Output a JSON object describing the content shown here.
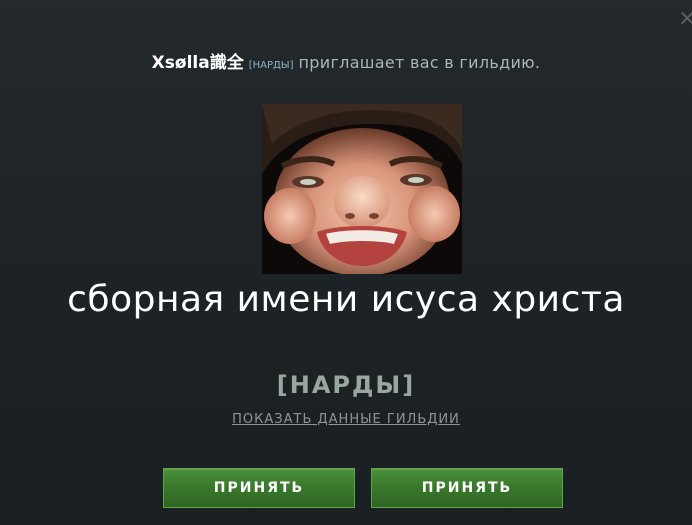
{
  "invite": {
    "inviter": "Xsølla識全",
    "inviter_tag": "[НАРДЫ]",
    "text": "приглашает вас в гильдию."
  },
  "guild": {
    "name": "сборная имени исуса христа",
    "tag": "[НАРДЫ]",
    "show_data_label": "ПОКАЗАТЬ ДАННЫЕ ГИЛЬДИИ"
  },
  "buttons": {
    "accept_left": "ПРИНЯТЬ",
    "accept_right": "ПРИНЯТЬ"
  },
  "icons": {
    "close": "close-icon"
  },
  "colors": {
    "accent_green": "#3b7a2d",
    "background": "#1d2326"
  }
}
